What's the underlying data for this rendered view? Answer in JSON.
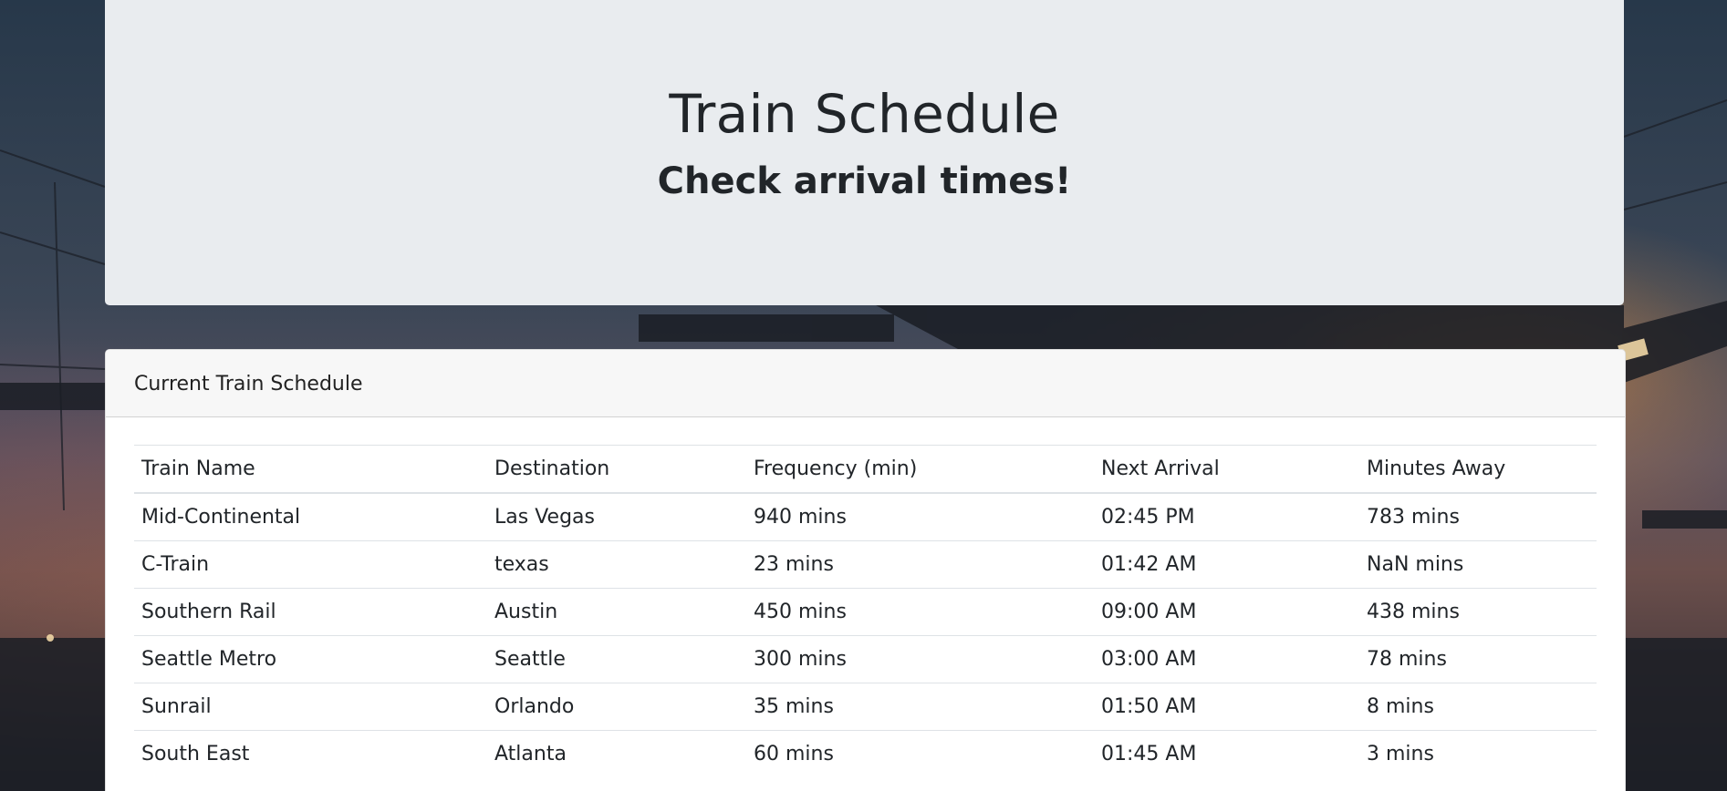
{
  "jumbotron": {
    "title": "Train Schedule",
    "subtitle": "Check arrival times!"
  },
  "schedule": {
    "header": "Current Train Schedule",
    "columns": [
      "Train Name",
      "Destination",
      "Frequency (min)",
      "Next Arrival",
      "Minutes Away"
    ],
    "rows": [
      [
        "Mid-Continental",
        "Las Vegas",
        "940 mins",
        "02:45 PM",
        "783 mins"
      ],
      [
        "C-Train",
        "texas",
        "23 mins",
        "01:42 AM",
        "NaN mins"
      ],
      [
        "Southern Rail",
        "Austin",
        "450 mins",
        "09:00 AM",
        "438 mins"
      ],
      [
        "Seattle Metro",
        "Seattle",
        "300 mins",
        "03:00 AM",
        "78 mins"
      ],
      [
        "Sunrail",
        "Orlando",
        "35 mins",
        "01:50 AM",
        "8 mins"
      ],
      [
        "South East",
        "Atlanta",
        "60 mins",
        "01:45 AM",
        "3 mins"
      ]
    ]
  },
  "colors": {
    "jumbotron_bg": "#e9ecef",
    "card_header_bg": "#f7f7f7",
    "text": "#212529"
  }
}
